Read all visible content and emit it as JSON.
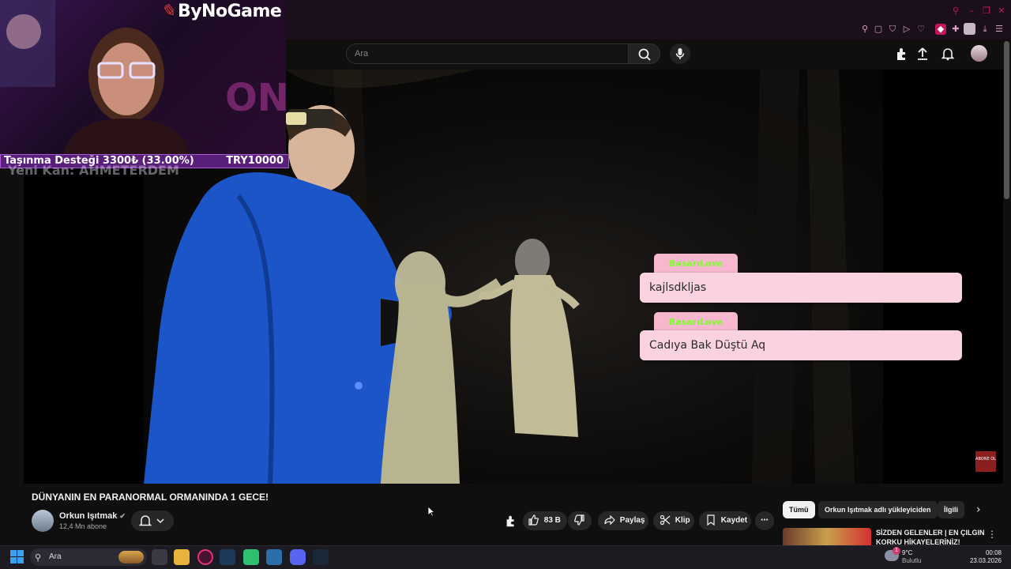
{
  "browser": {
    "window_controls": [
      "⚲",
      "–",
      "❐",
      "✕"
    ],
    "extensions": [
      "pin-icon",
      "square-icon",
      "shield-icon",
      "play-icon",
      "heart-icon",
      "extension-icon",
      "puzzle-icon",
      "profile-icon",
      "download-icon",
      "menu-icon"
    ]
  },
  "header": {
    "search_placeholder": "Ara"
  },
  "overlay": {
    "logo_text": "ByNoGame",
    "donation_label": "Taşınma Desteği 3300₺ (33.00%)",
    "donation_goal": "TRY10000",
    "donation_progress": 0.33,
    "recent_follower": "Yeni Kan: AHMETERDEM",
    "chat": [
      {
        "user": "BasarıLove",
        "message": "kajlsdkljas"
      },
      {
        "user": "BasarıLove",
        "message": "Cadıya Bak Düştü Aq"
      }
    ],
    "subscribe_mark": "ABONE OL"
  },
  "video": {
    "title": "DÜNYANIN EN PARANORMAL ORMANINDA 1 GECE!",
    "channel": "Orkun Işıtmak",
    "subscribers": "12,4 Mn abone",
    "likes": "83 B",
    "share_label": "Paylaş",
    "clip_label": "Klip",
    "save_label": "Kaydet"
  },
  "recommendations": {
    "chips": [
      "Tümü",
      "Orkun Işıtmak adlı yükleyiciden",
      "İlgili"
    ],
    "first_title": "SİZDEN GELENLER | EN ÇILGIN KORKU HİKAYELERİNİZ!"
  },
  "taskbar": {
    "search_label": "Ara",
    "weather_temp": "9°C",
    "weather_condition": "Bulutlu",
    "weather_badge": "1",
    "time": "00:08",
    "date": "23.03.2026"
  },
  "colors": {
    "accent": "#c2185b",
    "donation_bar": "#5a1f7a",
    "chat_bubble": "#fbd2e0",
    "chat_username": "#7cff2a"
  }
}
